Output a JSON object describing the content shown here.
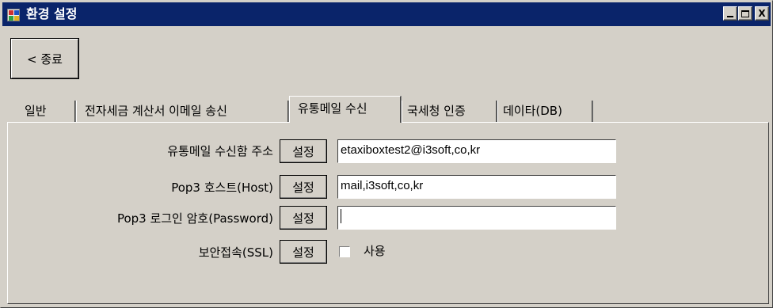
{
  "window": {
    "title": "환경 설정",
    "controls": {
      "minimize": "minimize",
      "maximize": "maximize",
      "close": "X"
    }
  },
  "toolbar": {
    "exit_label": "< 종료"
  },
  "tabs": [
    {
      "label": "일반",
      "active": false
    },
    {
      "label": "전자세금 계산서 이메일 송신",
      "active": false
    },
    {
      "label": "유통메일 수신",
      "active": true
    },
    {
      "label": "국세청 인증",
      "active": false
    },
    {
      "label": "데이타(DB)",
      "active": false
    }
  ],
  "form": {
    "set_button_label": "설정",
    "rows": [
      {
        "label": "유통메일 수신함 주소",
        "value": "etaxiboxtest2@i3soft,co,kr"
      },
      {
        "label": "Pop3 호스트(Host)",
        "value": "mail,i3soft,co,kr"
      },
      {
        "label": "Pop3 로그인 암호(Password)",
        "value": ""
      },
      {
        "label": "보안접속(SSL)",
        "checkbox_label": "사용",
        "checked": false
      }
    ]
  },
  "colors": {
    "titlebar": "#0a246a",
    "face": "#d4d0c8"
  }
}
